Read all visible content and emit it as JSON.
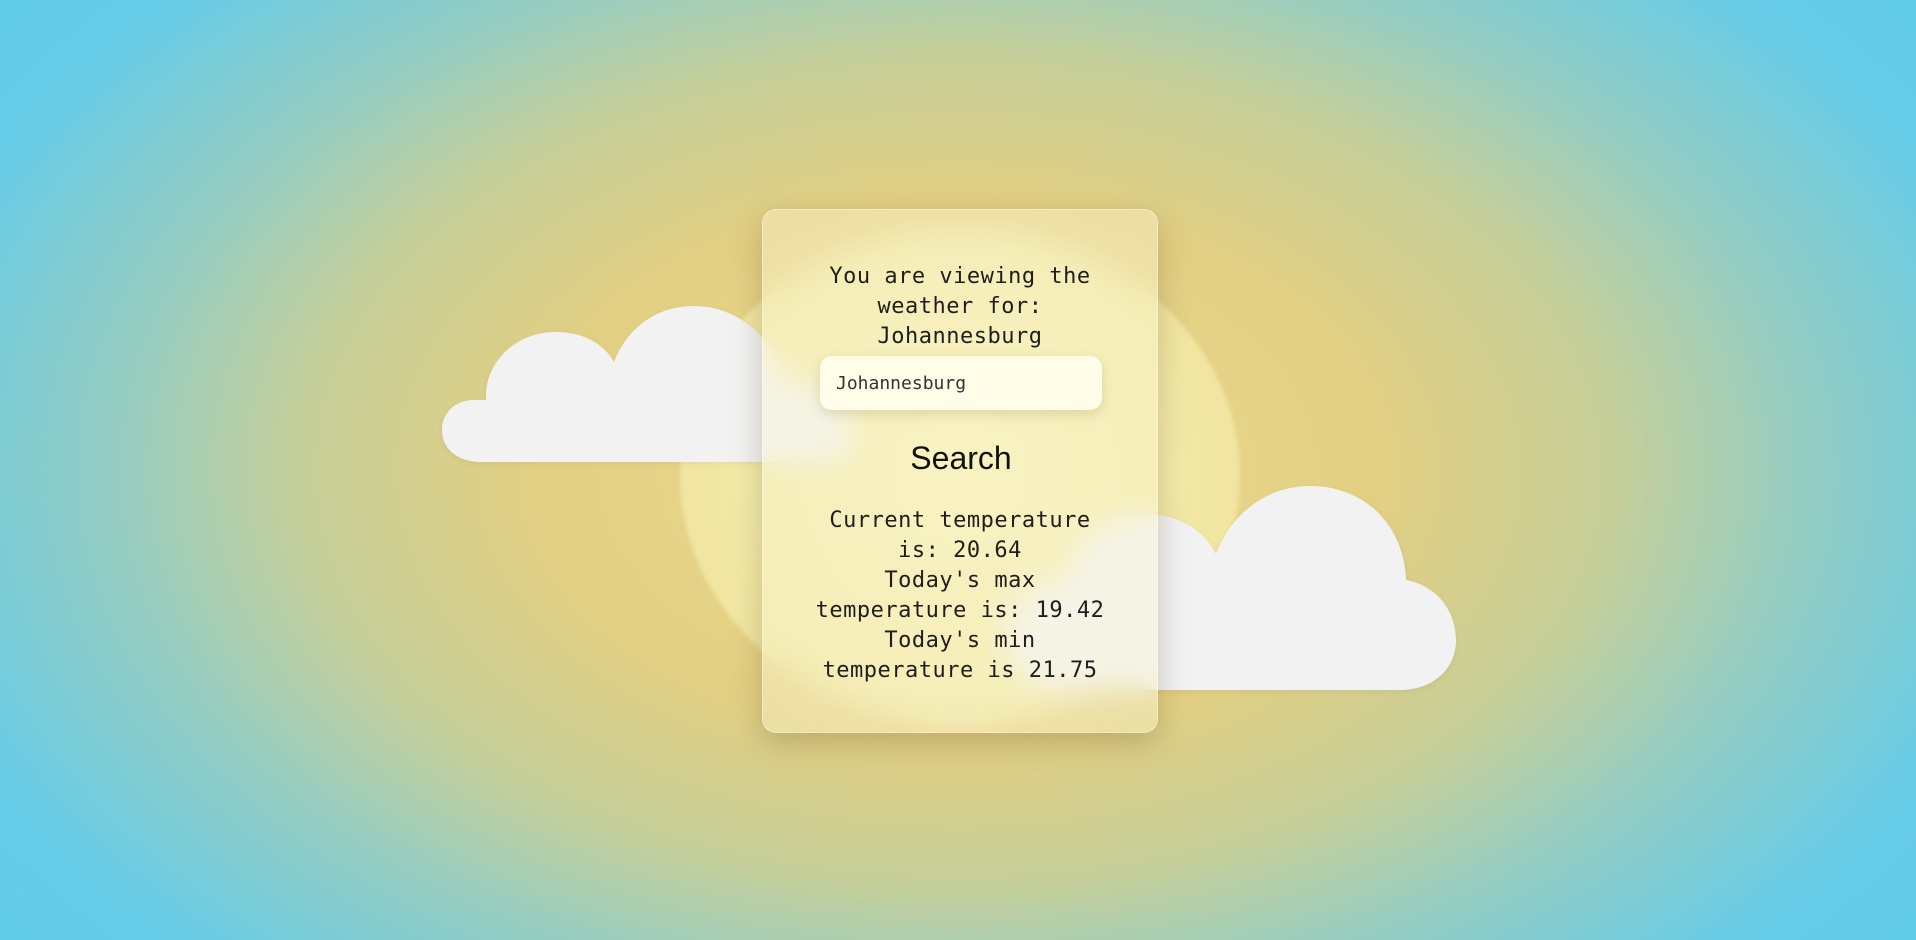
{
  "heading": {
    "line1": "You are viewing the weather for:",
    "city": "Johannesburg"
  },
  "search": {
    "value": "Johannesburg",
    "button_label": "Search"
  },
  "results": {
    "current": "Current temperature is: 20.64",
    "max": "Today's max temperature is: 19.42",
    "min": "Today's min temperature is 21.75"
  },
  "colors": {
    "sky": "#62cbe8",
    "sun_glow": "#e3cf82",
    "cloud": "#f2f2f2"
  }
}
